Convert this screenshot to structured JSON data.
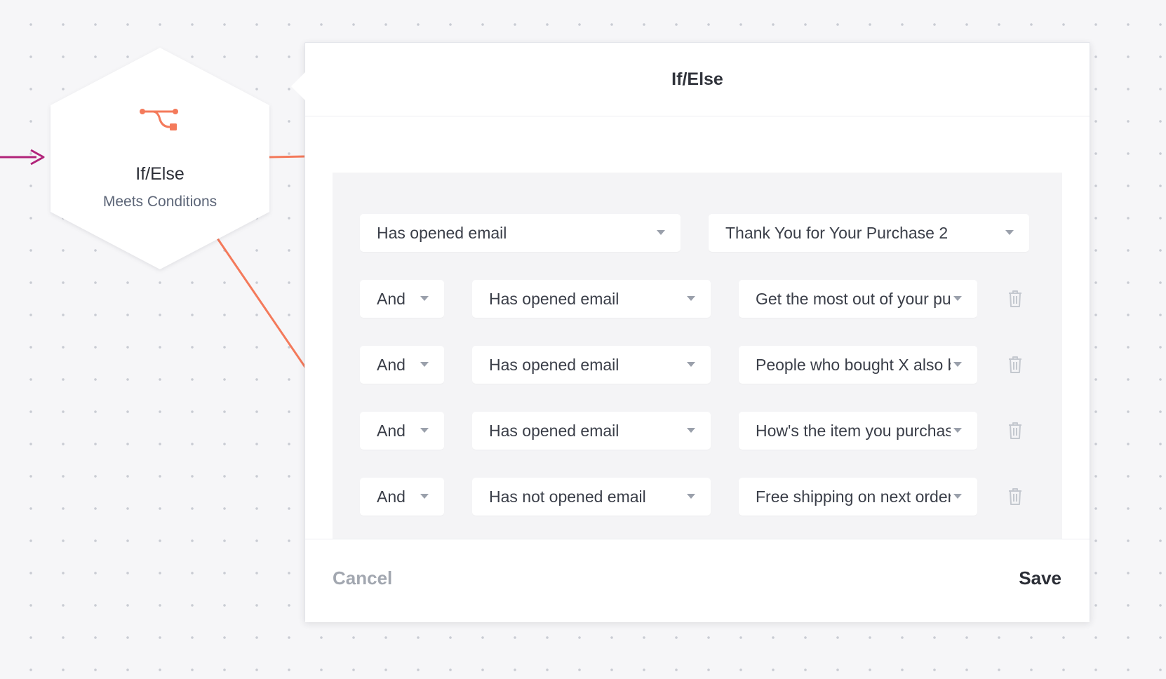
{
  "colors": {
    "accent": "#f47a5b",
    "incoming_line": "#b1247a"
  },
  "node": {
    "icon": "branch-icon",
    "title": "If/Else",
    "subtitle": "Meets Conditions"
  },
  "panel": {
    "title": "If/Else",
    "first_condition": {
      "field": "Has opened email",
      "value": "Thank You for Your Purchase 2"
    },
    "conditions": [
      {
        "conjunction": "And",
        "field": "Has opened email",
        "value": "Get the most out of your purchase"
      },
      {
        "conjunction": "And",
        "field": "Has opened email",
        "value": "People who bought X also bought"
      },
      {
        "conjunction": "And",
        "field": "Has opened email",
        "value": "How's the item you purchased"
      },
      {
        "conjunction": "And",
        "field": "Has not opened email",
        "value": "Free shipping on next order"
      }
    ],
    "cancel_label": "Cancel",
    "save_label": "Save"
  }
}
